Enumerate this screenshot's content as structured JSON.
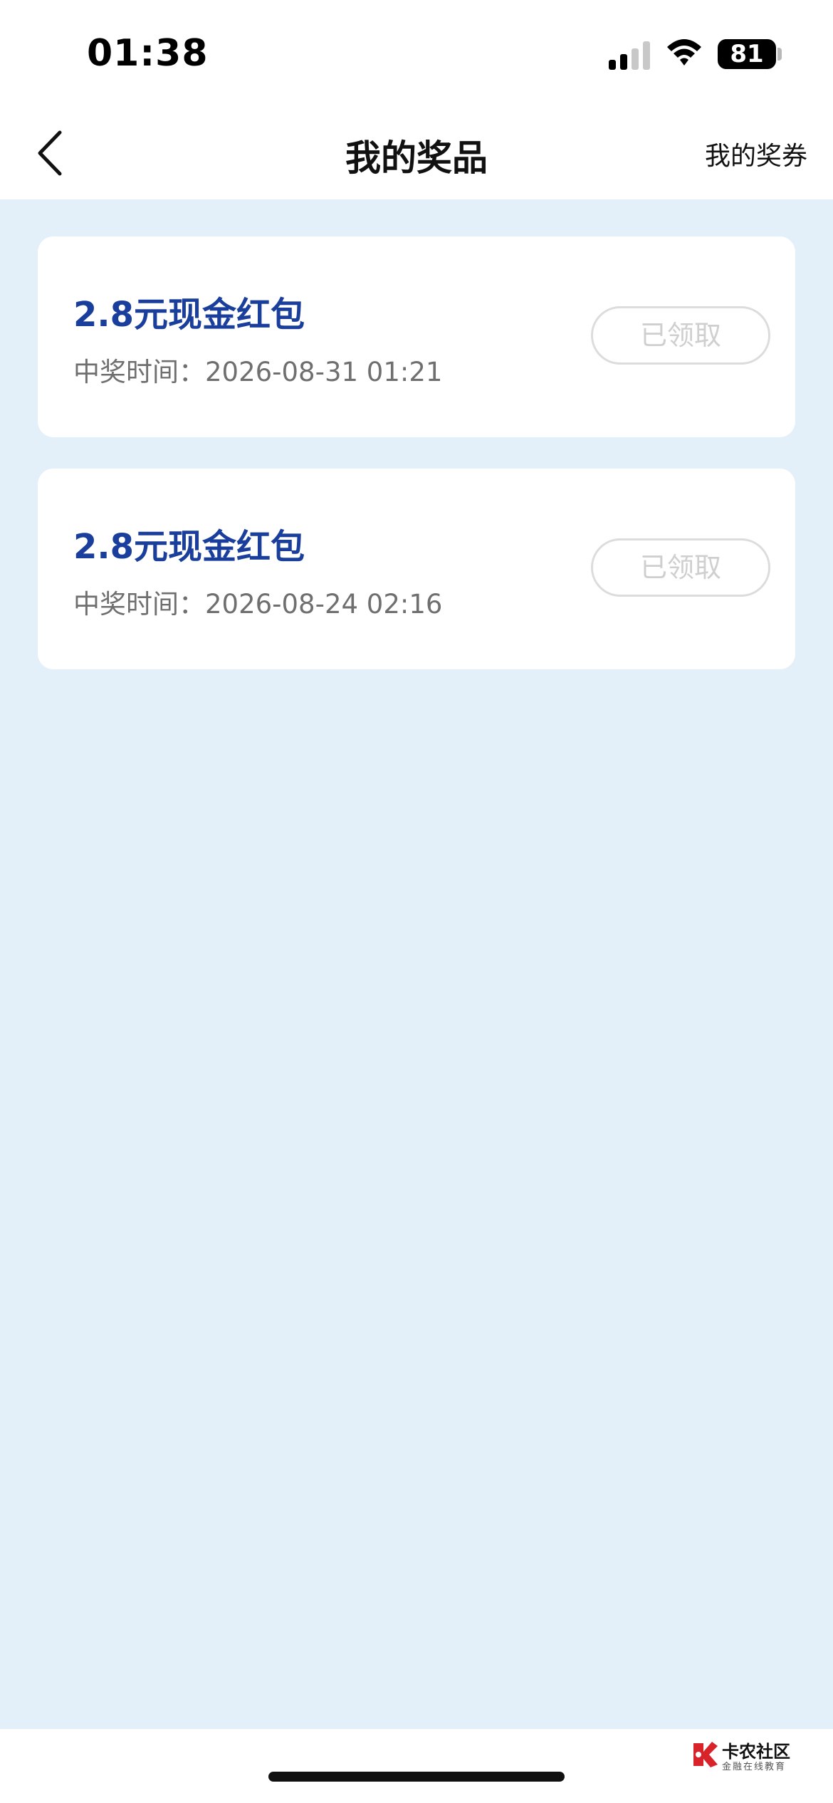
{
  "status_bar": {
    "time": "01:38",
    "battery": "81",
    "icons": [
      "signal-icon",
      "wifi-icon",
      "battery-icon"
    ]
  },
  "nav": {
    "back_icon": "chevron-left-icon",
    "title": "我的奖品",
    "right_link": "我的奖券"
  },
  "prizes": [
    {
      "title": "2.8元现金红包",
      "time": "中奖时间：2026-08-31 01:21",
      "button": "已领取"
    },
    {
      "title": "2.8元现金红包",
      "time": "中奖时间：2026-08-24 02:16",
      "button": "已领取"
    }
  ],
  "watermark": {
    "title": "卡农社区",
    "subtitle": "金融在线教育"
  },
  "colors": {
    "page_background": "#e3f0fa",
    "prize_title": "#1a3e9b",
    "disabled_button": "#cfcfcf"
  }
}
